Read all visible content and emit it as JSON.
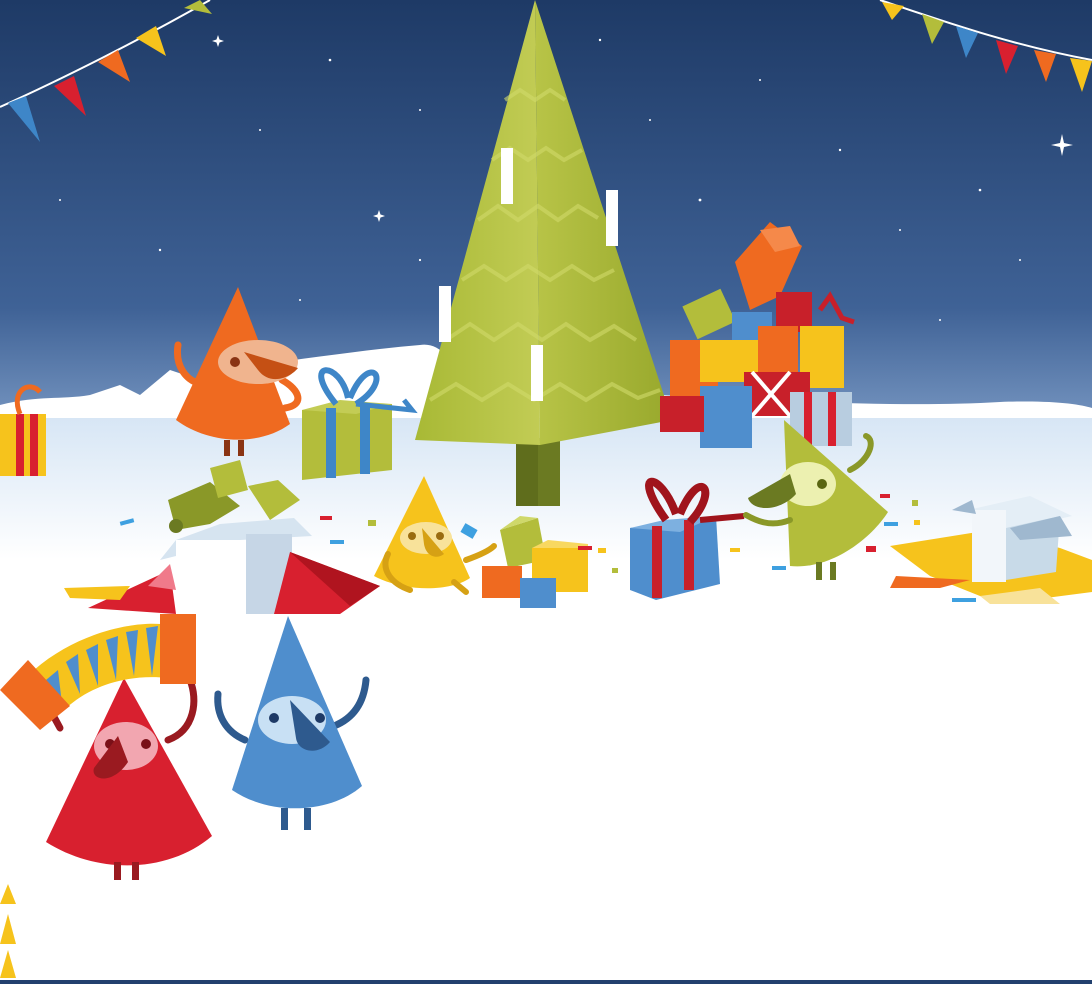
{
  "scene": {
    "colors": {
      "sky_top": "#1e3a66",
      "sky_bottom": "#6f8fbb",
      "snow": "#ffffff",
      "tree": "#b2c040",
      "trunk": "#6b7a22",
      "red": "#d8202f",
      "orange": "#ef6a20",
      "yellow": "#f6c31c",
      "blue": "#4f8ecd",
      "green": "#b3bd3b",
      "bottom_bar": "#22406e"
    },
    "characters": [
      "red-elf",
      "blue-elf",
      "orange-elf",
      "yellow-elf",
      "green-elf"
    ],
    "icons": [
      "christmas-tree-icon",
      "gift-icon",
      "bunting-icon",
      "star-icon",
      "confetti-icon"
    ]
  }
}
